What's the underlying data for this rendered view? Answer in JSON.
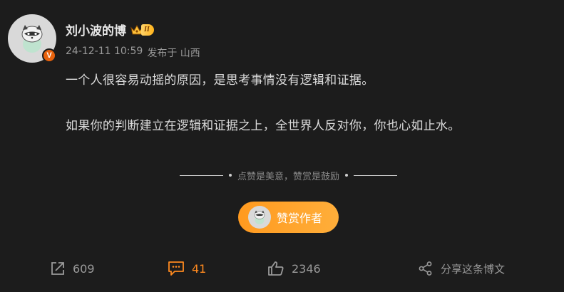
{
  "post": {
    "username": "刘小波的博",
    "level": "II",
    "timestamp": "24-12-11 10:59",
    "source": "发布于 山西",
    "paragraphs": [
      "一个人很容易动摇的原因，是思考事情没有逻辑和证据。",
      "如果你的判断建立在逻辑和证据之上，全世界人反对你，你也心如止水。"
    ]
  },
  "reward": {
    "divider_text": "点赞是美意，赞赏是鼓励",
    "button_label": "赞赏作者"
  },
  "actions": {
    "repost_count": "609",
    "comment_count": "41",
    "like_count": "2346",
    "share_label": "分享这条博文"
  },
  "icons": {
    "verified": "V",
    "repost": "repost-icon",
    "comment": "comment-icon",
    "like": "like-icon",
    "share": "share-icon"
  },
  "colors": {
    "background": "#1c1c1c",
    "accent_orange": "#ff9a1f",
    "verified_badge": "#e8620c"
  }
}
